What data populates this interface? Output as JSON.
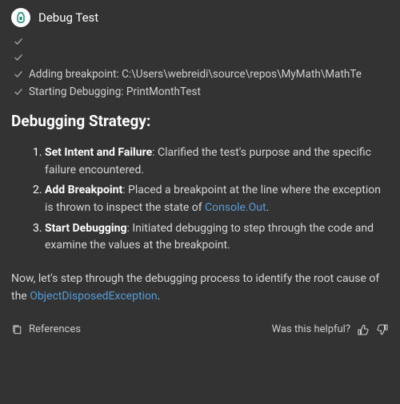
{
  "header": {
    "title": "Debug Test"
  },
  "progress": [
    {
      "label": ""
    },
    {
      "label": ""
    },
    {
      "label": "Adding breakpoint: C:\\Users\\webreidi\\source\\repos\\MyMath\\MathTe"
    },
    {
      "label": "Starting Debugging: PrintMonthTest"
    }
  ],
  "strategy": {
    "title": "Debugging Strategy:",
    "steps": [
      {
        "title": "Set Intent and Failure",
        "desc": ": Clarified the test's purpose and the specific failure encountered."
      },
      {
        "title": "Add Breakpoint",
        "desc_prefix": ": Placed a breakpoint at the line where the exception is thrown to inspect the state of ",
        "link": "Console.Out",
        "desc_suffix": "."
      },
      {
        "title": "Start Debugging",
        "desc": ": Initiated debugging to step through the code and examine the values at the breakpoint."
      }
    ]
  },
  "body": {
    "prefix": "Now, let's step through the debugging process to identify the root cause of the ",
    "link": "ObjectDisposedException",
    "suffix": "."
  },
  "footer": {
    "references": "References",
    "helpful_label": "Was this helpful?"
  }
}
